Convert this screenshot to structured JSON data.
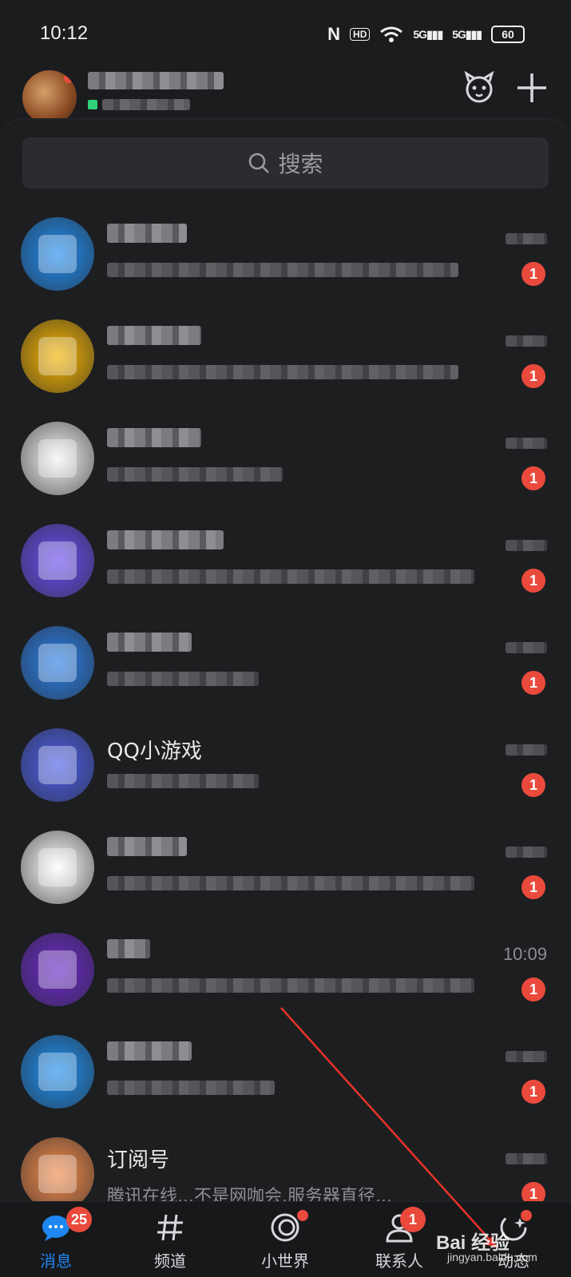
{
  "status_bar": {
    "time": "10:12",
    "nfc": "N",
    "hd": "HD",
    "signal_1": "5G",
    "signal_2": "5G",
    "battery": "60"
  },
  "header": {
    "avatar_icon": "user-avatar",
    "online_color": "#2fd27a",
    "pet_icon": "pet-face-icon",
    "add_icon": "plus-icon"
  },
  "search": {
    "placeholder": "搜索"
  },
  "chats": [
    {
      "title": "",
      "preview": "",
      "time": "",
      "unread": "1",
      "avatar_color": "#1f8cf0",
      "title_width": 100,
      "preview_width": 440
    },
    {
      "title": "",
      "preview": "",
      "time": "",
      "unread": "1",
      "avatar_color": "#f5b400",
      "title_width": 118,
      "preview_width": 440
    },
    {
      "title": "",
      "preview": "",
      "time": "",
      "unread": "1",
      "avatar_color": "#f4f4f4",
      "title_width": 118,
      "preview_width": 220
    },
    {
      "title": "",
      "preview": "",
      "time": "",
      "unread": "1",
      "avatar_color": "#6b4cf2",
      "title_width": 146,
      "preview_width": 460
    },
    {
      "title": "",
      "preview": "",
      "time": "",
      "unread": "1",
      "avatar_color": "#2a7fe8",
      "title_width": 106,
      "preview_width": 190
    },
    {
      "title": "QQ小游戏",
      "preview": "",
      "time": "",
      "unread": "1",
      "avatar_color": "#4b5fe8",
      "title_width": 0,
      "preview_width": 190
    },
    {
      "title": "",
      "preview": "",
      "time": "",
      "unread": "1",
      "avatar_color": "#ffffff",
      "title_width": 100,
      "preview_width": 460
    },
    {
      "title": "",
      "preview": "",
      "time": "10:09",
      "unread": "1",
      "avatar_color": "#6a28c8",
      "title_width": 54,
      "preview_width": 460
    },
    {
      "title": "",
      "preview": "",
      "time": "",
      "unread": "1",
      "avatar_color": "#1d8ff0",
      "title_width": 106,
      "preview_width": 210
    },
    {
      "title": "订阅号",
      "preview": "腾讯在线...不是网咖会.服务器直径...",
      "time": "",
      "unread": "1",
      "avatar_color": "#f38b4a",
      "title_width": 0,
      "preview_width": 0
    }
  ],
  "tabs": [
    {
      "label": "消息",
      "badge": "25",
      "icon": "message-bubble-icon"
    },
    {
      "label": "频道",
      "badge": "",
      "icon": "hash-icon"
    },
    {
      "label": "小世界",
      "badge": "",
      "icon": "circle-world-icon"
    },
    {
      "label": "联系人",
      "badge": "1",
      "icon": "person-icon"
    },
    {
      "label": "动态",
      "badge": "",
      "icon": "star-sparkle-icon"
    }
  ],
  "watermark": {
    "brand": "Bai 经验",
    "url": "jingyan.baidu.com"
  },
  "colors": {
    "accent": "#1e87f0",
    "badge": "#ea4a3c",
    "background": "#1b1c1e"
  }
}
